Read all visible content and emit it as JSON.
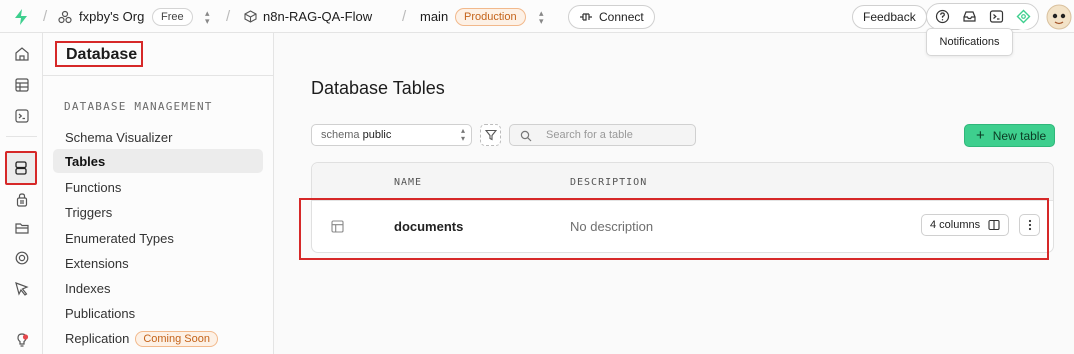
{
  "topbar": {
    "org": "fxpby's Org",
    "plan": "Free",
    "project": "n8n-RAG-QA-Flow",
    "branch": "main",
    "environment": "Production",
    "connect_label": "Connect",
    "feedback_label": "Feedback",
    "separator": "/"
  },
  "tooltip": {
    "text": "Notifications"
  },
  "sidebar": {
    "title": "Database",
    "section_label": "DATABASE MANAGEMENT",
    "items": [
      {
        "label": "Schema Visualizer"
      },
      {
        "label": "Tables"
      },
      {
        "label": "Functions"
      },
      {
        "label": "Triggers"
      },
      {
        "label": "Enumerated Types"
      },
      {
        "label": "Extensions"
      },
      {
        "label": "Indexes"
      },
      {
        "label": "Publications"
      },
      {
        "label": "Replication"
      }
    ],
    "replication_badge": "Coming Soon"
  },
  "main": {
    "title": "Database Tables",
    "schema_prefix": "schema",
    "schema_value": "public",
    "search_placeholder": "Search for a table",
    "new_table_label": "New table",
    "columns": {
      "name": "NAME",
      "description": "DESCRIPTION"
    },
    "rows": [
      {
        "name": "documents",
        "description": "No description",
        "columns_label": "4 columns"
      }
    ]
  },
  "colors": {
    "accent_green": "#3ecf8e",
    "highlight_red": "#d62828",
    "badge_orange": "#c4631a"
  }
}
